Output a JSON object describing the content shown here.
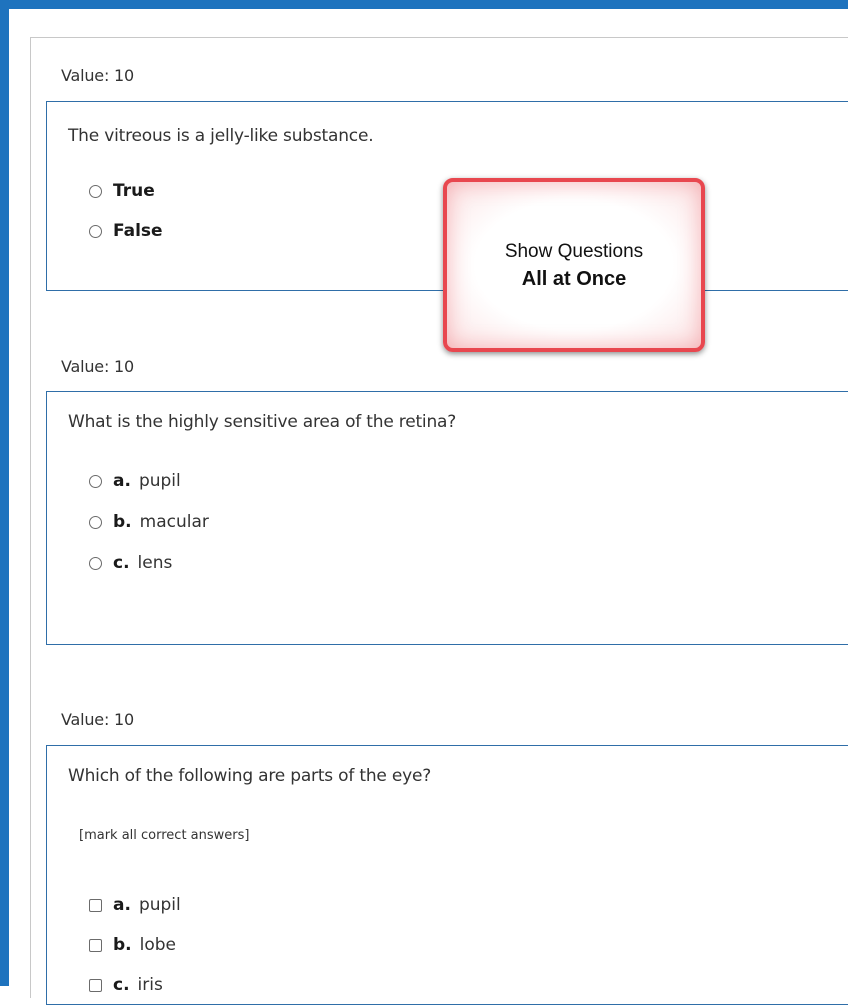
{
  "questions": [
    {
      "value_label": "Value: 10",
      "text": "The vitreous is a jelly-like substance.",
      "options": [
        {
          "label": "True"
        },
        {
          "label": "False"
        }
      ]
    },
    {
      "value_label": "Value: 10",
      "text": "What is the highly sensitive area of the retina?",
      "options": [
        {
          "letter": "a.",
          "label": "pupil"
        },
        {
          "letter": "b.",
          "label": "macular"
        },
        {
          "letter": "c.",
          "label": "lens"
        }
      ]
    },
    {
      "value_label": "Value: 10",
      "text": "Which of the following are parts of the eye?",
      "hint": "[mark all correct answers]",
      "options": [
        {
          "letter": "a.",
          "label": "pupil"
        },
        {
          "letter": "b.",
          "label": "lobe"
        },
        {
          "letter": "c.",
          "label": "iris"
        }
      ]
    }
  ],
  "callout": {
    "line1": "Show Questions",
    "line2": "All at Once"
  },
  "colors": {
    "frame": "#1e73be",
    "question_border": "#2f6ea8",
    "callout_border": "#e8474f"
  }
}
